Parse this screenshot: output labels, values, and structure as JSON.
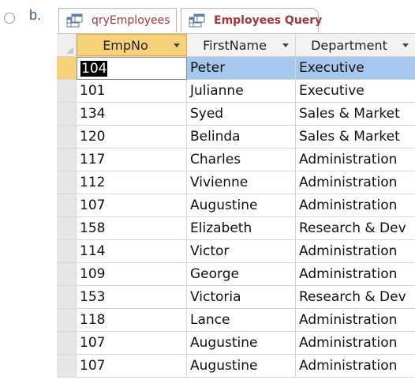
{
  "option": {
    "letter": "b."
  },
  "tabs": [
    {
      "label": "qryEmployees",
      "icon": "query-icon"
    },
    {
      "label": "Employees Query",
      "icon": "query-icon",
      "active": true
    }
  ],
  "columns": [
    {
      "label": "EmpNo"
    },
    {
      "label": "FirstName"
    },
    {
      "label": "Department"
    }
  ],
  "rows": [
    {
      "empno": "104",
      "first": "Peter",
      "dept": "Executive"
    },
    {
      "empno": "101",
      "first": "Julianne",
      "dept": "Executive"
    },
    {
      "empno": "134",
      "first": "Syed",
      "dept": "Sales & Market"
    },
    {
      "empno": "120",
      "first": "Belinda",
      "dept": "Sales & Market"
    },
    {
      "empno": "117",
      "first": "Charles",
      "dept": "Administration"
    },
    {
      "empno": "112",
      "first": "Vivienne",
      "dept": "Administration"
    },
    {
      "empno": "107",
      "first": "Augustine",
      "dept": "Administration"
    },
    {
      "empno": "158",
      "first": "Elizabeth",
      "dept": "Research & Dev"
    },
    {
      "empno": "114",
      "first": "Victor",
      "dept": "Administration"
    },
    {
      "empno": "109",
      "first": "George",
      "dept": "Administration"
    },
    {
      "empno": "153",
      "first": "Victoria",
      "dept": "Research & Dev"
    },
    {
      "empno": "118",
      "first": "Lance",
      "dept": "Administration"
    },
    {
      "empno": "107",
      "first": "Augustine",
      "dept": "Administration"
    },
    {
      "empno": "107",
      "first": "Augustine",
      "dept": "Administration"
    }
  ],
  "colors": {
    "tab_text": "#a4373a",
    "sorted_header": "#f8d27b",
    "selected_row": "#a6c8ec"
  }
}
